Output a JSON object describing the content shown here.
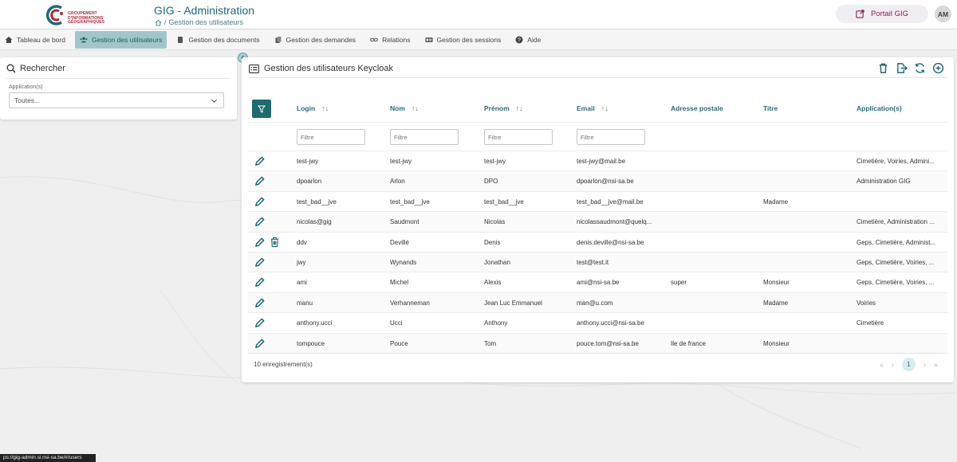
{
  "header": {
    "logo_text_line1": "GROUPEMENT",
    "logo_text_line2": "D'INFORMATIONS",
    "logo_text_line3": "GÉOGRAPHIQUES",
    "app_title": "GIG - Administration",
    "breadcrumb_sep": "/",
    "breadcrumb_current": "Gestion des utilisateurs",
    "portal_label": "Portail GIG",
    "avatar_initials": "AM"
  },
  "nav": {
    "items": [
      {
        "label": "Tableau de bord",
        "icon": "home-icon"
      },
      {
        "label": "Gestion des utilisateurs",
        "icon": "users-icon",
        "active": true
      },
      {
        "label": "Gestion des documents",
        "icon": "document-icon"
      },
      {
        "label": "Gestion des demandes",
        "icon": "copy-icon"
      },
      {
        "label": "Relations",
        "icon": "link-icon"
      },
      {
        "label": "Gestion des sessions",
        "icon": "id-card-icon"
      },
      {
        "label": "Aide",
        "icon": "help-icon"
      }
    ]
  },
  "search": {
    "title": "Rechercher",
    "field_label": "Application(s)",
    "field_value": "Toutes..."
  },
  "main": {
    "title": "Gestion des utilisateurs Keycloak",
    "columns": {
      "login": "Login",
      "nom": "Nom",
      "prenom": "Prénom",
      "email": "Email",
      "adresse": "Adresse postale",
      "titre": "Titre",
      "applications": "Application(s)"
    },
    "filter_placeholder": "Filtre",
    "rows": [
      {
        "login": "test-jwy",
        "nom": "test-jwy",
        "prenom": "test-jwy",
        "email": "test-jwy@mail.be",
        "adresse": "",
        "titre": "",
        "applications": "Cimetière, Voiries, Admini..."
      },
      {
        "login": "dpoarlon",
        "nom": "Arlon",
        "prenom": "DPO",
        "email": "dpoarlon@nsi-sa.be",
        "adresse": "",
        "titre": "",
        "applications": "Administration GIG"
      },
      {
        "login": "test_bad__jve",
        "nom": "test_bad__jve",
        "prenom": "test_bad__jve",
        "email": "test_bad__jve@mail.be",
        "adresse": "",
        "titre": "Madame",
        "applications": ""
      },
      {
        "login": "nicolas@gig",
        "nom": "Saudmont",
        "prenom": "Nicolas",
        "email": "nicolassaudmont@quelq...",
        "adresse": "",
        "titre": "",
        "applications": "Cimetière, Administration ..."
      },
      {
        "login": "ddv",
        "nom": "Devillé",
        "prenom": "Denis",
        "email": "denis.deville@nsi-sa.be",
        "adresse": "",
        "titre": "",
        "applications": "Geps, Cimetière, Administ...",
        "deletable": true
      },
      {
        "login": "jwy",
        "nom": "Wynands",
        "prenom": "Jonathan",
        "email": "test@test.it",
        "adresse": "",
        "titre": "",
        "applications": "Geps, Cimetière, Voiries, ..."
      },
      {
        "login": "ami",
        "nom": "Michel",
        "prenom": "Alexis",
        "email": "ami@nsi-sa.be",
        "adresse": "super",
        "titre": "Monsieur",
        "applications": "Geps, Cimetière, Voiries, ..."
      },
      {
        "login": "manu",
        "nom": "Verhanneman",
        "prenom": "Jean Luc Emmanuel",
        "email": "man@u.com",
        "adresse": "",
        "titre": "Madame",
        "applications": "Voiries"
      },
      {
        "login": "anthony.ucci",
        "nom": "Ucci",
        "prenom": "Anthony",
        "email": "anthony.ucci@nsi-sa.be",
        "adresse": "",
        "titre": "",
        "applications": "Cimetière"
      },
      {
        "login": "tompouce",
        "nom": "Pouce",
        "prenom": "Tom",
        "email": "pouce.tom@nsi-sa.be",
        "adresse": "Ile de france",
        "titre": "Monsieur",
        "applications": ""
      }
    ],
    "record_count": "10 enregistrement(s)",
    "pager": {
      "first": "«",
      "prev": "‹",
      "current": "1",
      "next": "›",
      "last": "»"
    }
  },
  "status_bar": {
    "url": "ps://gig-admin.si.nsi-sa.be/#/users"
  },
  "colors": {
    "accent": "#1d6b6e",
    "nav_active": "#9fc7c9",
    "portal": "#8a1e4e",
    "logo": "#b02a3a"
  }
}
